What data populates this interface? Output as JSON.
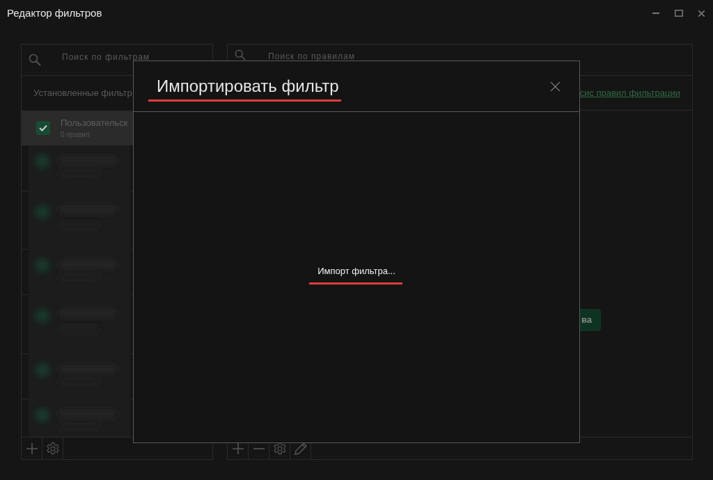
{
  "window": {
    "title": "Редактор фильтров"
  },
  "filters_panel": {
    "search_placeholder": "Поиск по фильтрам",
    "section_title": "Установленные фильтр",
    "items": [
      {
        "kind": "filter",
        "name": "Пользовательск",
        "rules": "0 правил",
        "checked": true,
        "selected": true
      },
      {
        "kind": "blurred"
      },
      {
        "kind": "blurred"
      },
      {
        "kind": "blurred"
      },
      {
        "kind": "blurred"
      },
      {
        "kind": "blurred"
      },
      {
        "kind": "blurred"
      }
    ]
  },
  "rules_panel": {
    "search_placeholder": "Поиск по правилам",
    "link": "сис правил фильтрации",
    "button": "ва"
  },
  "dialog": {
    "title": "Импортировать фильтр",
    "message": "Импорт фильтра...",
    "underlined": true
  }
}
